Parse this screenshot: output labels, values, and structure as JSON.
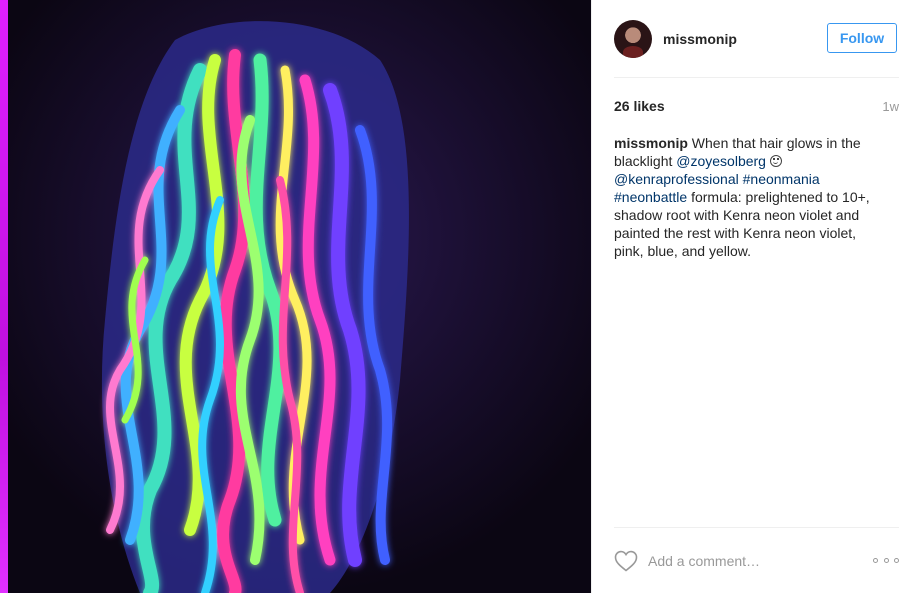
{
  "post": {
    "image_alt": "Neon glowing wavy hair under blacklight",
    "author": "missmonip",
    "follow_label": "Follow",
    "likes_text": "26 likes",
    "time_ago": "1w",
    "caption": {
      "username": "missmonip",
      "text_1": " When that hair glows in the blacklight ",
      "mention_1": "@zoyesolberg",
      "emoji": "smiley-icon",
      "mention_2": "@kenraprofessional",
      "hashtag_1": "#neonmania",
      "hashtag_2": "#neonbattle",
      "text_2": " formula: prelightened to 10+, shadow root with Kenra neon violet and painted the rest with Kenra neon violet, pink, blue, and yellow."
    },
    "comment_placeholder": "Add a comment…"
  },
  "colors": {
    "link": "#003569",
    "follow": "#3897f0",
    "muted": "#999999"
  }
}
